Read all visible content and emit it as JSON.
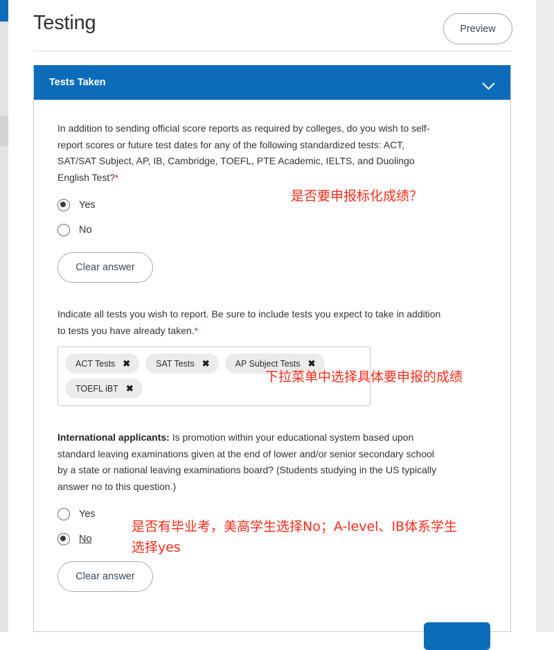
{
  "header": {
    "title": "Testing",
    "preview_label": "Preview"
  },
  "card": {
    "title": "Tests Taken",
    "collapse_icon": "chevron-down-icon",
    "accent_color": "#0d6cb9"
  },
  "questions": [
    {
      "id": "self-report-scores",
      "text": "In addition to sending official score reports as required by colleges, do you wish to self-report scores or future test dates for any of the following standardized tests: ACT, SAT/SAT Subject, AP, IB, Cambridge, TOEFL, PTE Academic, IELTS, and Duolingo English Test?",
      "required_marker": "*",
      "options": [
        {
          "label": "Yes",
          "selected": true
        },
        {
          "label": "No",
          "selected": false
        }
      ],
      "clear_answer_label": "Clear answer"
    },
    {
      "id": "indicate-all-tests",
      "text": "Indicate all tests you wish to report. Be sure to include tests you expect to take in addition to tests you have already taken.",
      "required_marker": "*",
      "chips": [
        {
          "label": "ACT Tests",
          "remove_icon": "close-icon"
        },
        {
          "label": "SAT Tests",
          "remove_icon": "close-icon"
        },
        {
          "label": "AP Subject Tests",
          "remove_icon": "close-icon"
        },
        {
          "label": "TOEFL iBT",
          "remove_icon": "close-icon"
        }
      ]
    },
    {
      "id": "international-applicants",
      "lead": "International applicants:",
      "text": " Is promotion within your educational system based upon standard leaving examinations given at the end of lower and/or senior secondary school by a state or national leaving examinations board? (Students studying in the US typically answer no to this question.)",
      "options": [
        {
          "label": "Yes",
          "selected": false
        },
        {
          "label": "No",
          "selected": true
        }
      ],
      "clear_answer_label": "Clear answer"
    }
  ],
  "annotations": [
    {
      "id": "annotation-standardized",
      "text": "是否要申报标化成绩？",
      "color": "#ff2a19"
    },
    {
      "id": "annotation-dropdown",
      "text": "下拉菜单中选择具体要申报的成绩",
      "color": "#ff2a19"
    },
    {
      "id": "annotation-graduation-exam",
      "text": "是否有毕业考，美高学生选择No；A-level、IB体系学生\n选择yes",
      "color": "#ff2a19"
    }
  ]
}
